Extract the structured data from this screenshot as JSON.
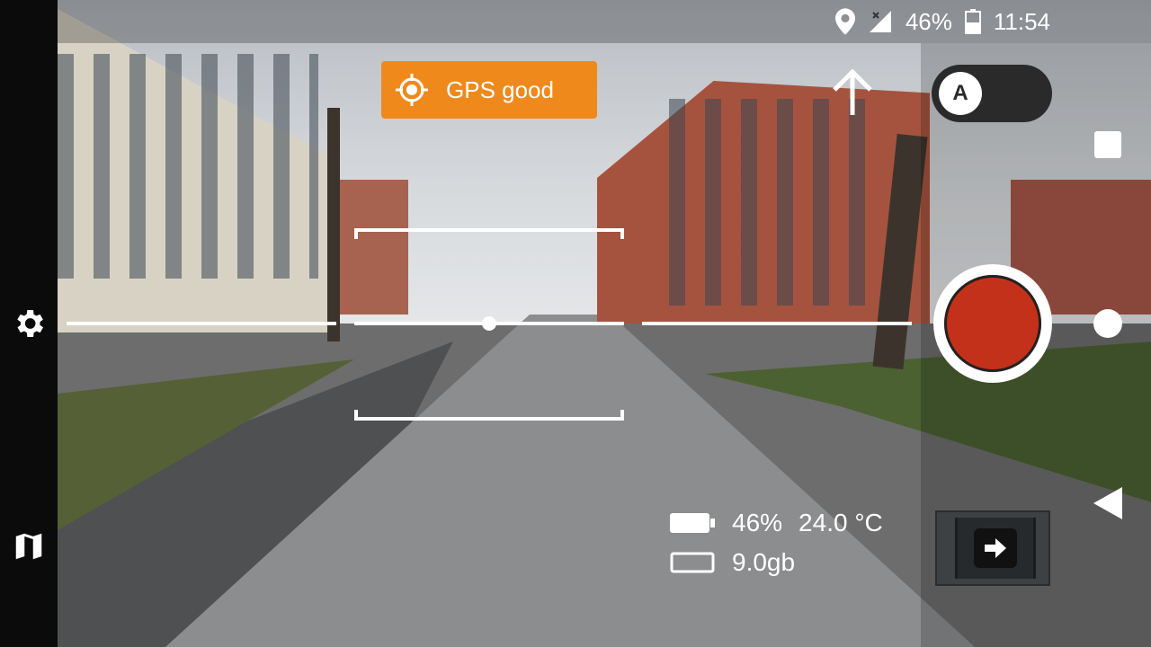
{
  "status_bar": {
    "battery_percent": "46%",
    "time": "11:54",
    "icons": [
      "location-icon",
      "signal-icon",
      "battery-icon"
    ]
  },
  "gps": {
    "label": "GPS good",
    "icon": "crosshair-icon",
    "color": "#f0891b"
  },
  "mode_toggle": {
    "label": "A"
  },
  "left_rail": {
    "icons": [
      "settings-icon",
      "map-icon"
    ]
  },
  "device_info": {
    "battery": "46%",
    "temperature": "24.0 °C",
    "storage": "9.0gb"
  },
  "colors": {
    "record": "#c4311a",
    "accent": "#f0891b"
  }
}
